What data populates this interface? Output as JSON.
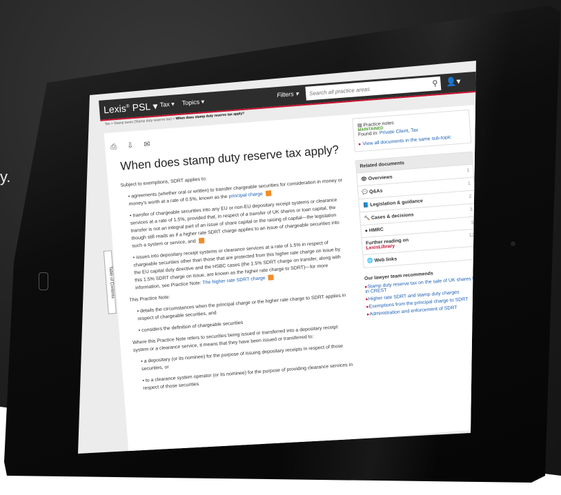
{
  "edge_text": "y.",
  "app": {
    "logo": "Lexis",
    "logo_sup": "®",
    "logo_suffix": "PSL",
    "nav": [
      "Tax",
      "Topics"
    ],
    "filters_label": "Filters",
    "search_placeholder": "Search all practice areas"
  },
  "breadcrumb": {
    "path": "Tax > Stamp taxes (Stamp duty reserve tax) >",
    "current": "When does stamp duty reserve tax apply?"
  },
  "toc_label": "Table of Contents",
  "doc": {
    "title": "When does stamp duty reserve tax apply?",
    "intro": "Subject to exemptions, SDRT applies to:",
    "items": [
      {
        "text": "agreements (whether oral or written) to transfer chargeable securities for consideration in money or money's worth at a rate of 0.5%, known as the",
        "link": "principal charge"
      },
      {
        "text": "transfer of chargeable securities into any EU or non-EU depositary receipt systems or clearance services at a rate of 1.5%, provided that, in respect of a transfer of UK shares or loan capital, the transfer is not an integral part of an issue of share capital or the raising of capital—the legislation though still reads as if a higher rate SDRT charge applies to an issue of chargeable securities into such a system or service, and",
        "link": ""
      },
      {
        "text": "issues into depositary receipt systems or clearance services at a rate of 1.5% in respect of chargeable securities other than those that are protected from this higher rate charge on issue by the EU capital duty directive and the HSBC cases (the 1.5% SDRT charge on transfer, along with this 1.5% SDRT charge on issue, are known as the higher rate charge to SDRT)—for more information, see Practice Note:",
        "link": "The higher rate SDRT charge"
      }
    ],
    "para2": "This Practice Note:",
    "items2": [
      "details the circumstances when the principal charge or the higher rate charge to SDRT applies in respect of chargeable securities, and",
      "considers the definition of chargeable securities"
    ],
    "para3": "Where this Practice Note refers to securities being issued or transferred into a depositary receipt system or a clearance service, it means that they have been issued or transferred to:",
    "items3": [
      "a depositary (or its nominee) for the purpose of issuing depositary receipts in respect of those securities, or",
      "to a clearance system operator (or its nominee) for the purpose of providing clearance services in respect of those securities"
    ]
  },
  "sidebar": {
    "practice_label": "Practice notes",
    "maintained": "MAINTAINED",
    "found_in": "Found in:",
    "found_links": "Private Client, Tax",
    "view_all": "View all documents in the same sub-topic",
    "related_header": "Related documents",
    "related": [
      {
        "label": "Overviews",
        "count": "1"
      },
      {
        "label": "Q&As",
        "count": "1"
      },
      {
        "label": "Legislation & guidance",
        "count": "2"
      },
      {
        "label": "Cases & decisions",
        "count": "3"
      },
      {
        "label": "HMRC",
        "count": "3"
      },
      {
        "label": "Further reading on",
        "sub": "LexisLibrary",
        "count": "12"
      },
      {
        "label": "Web links",
        "count": "1"
      }
    ],
    "rec_header": "Our lawyer team recommends",
    "recs": [
      "Stamp duty reserve tax on the sale of UK shares held in CREST",
      "Higher rate SDRT and stamp duty charges",
      "Exemptions from the principal charge to SDRT",
      "Administration and enforcement of SDRT"
    ]
  }
}
